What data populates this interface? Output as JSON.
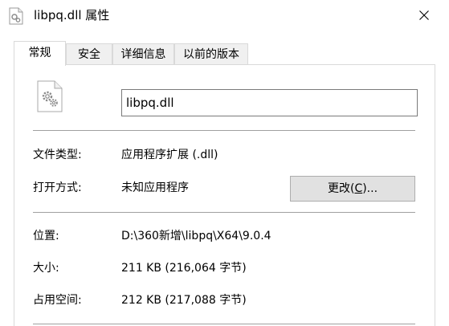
{
  "window": {
    "title": "libpq.dll 属性",
    "close_icon": "close-icon",
    "title_icon": "dll-file-icon"
  },
  "tabs": [
    {
      "label": "常规",
      "active": true
    },
    {
      "label": "安全",
      "active": false
    },
    {
      "label": "详细信息",
      "active": false
    },
    {
      "label": "以前的版本",
      "active": false
    }
  ],
  "general": {
    "file_icon": "dll-file-gear-icon",
    "file_name": "libpq.dll",
    "type_label": "文件类型:",
    "type_value": "应用程序扩展 (.dll)",
    "opens_label": "打开方式:",
    "opens_value": "未知应用程序",
    "change_button": {
      "before": "更改(",
      "accel": "C",
      "after": ")..."
    },
    "location_label": "位置:",
    "location_value": "D:\\360新增\\libpq\\X64\\9.0.4",
    "size_label": "大小:",
    "size_value": "211 KB (216,064 字节)",
    "disk_label": "占用空间:",
    "disk_value": "212 KB (217,088 字节)"
  },
  "colors": {
    "border": "#d9d9d9",
    "separator": "#a0a0a0",
    "button_bg": "#e1e1e1",
    "inactive_tab_bg": "#f0f0f0"
  }
}
